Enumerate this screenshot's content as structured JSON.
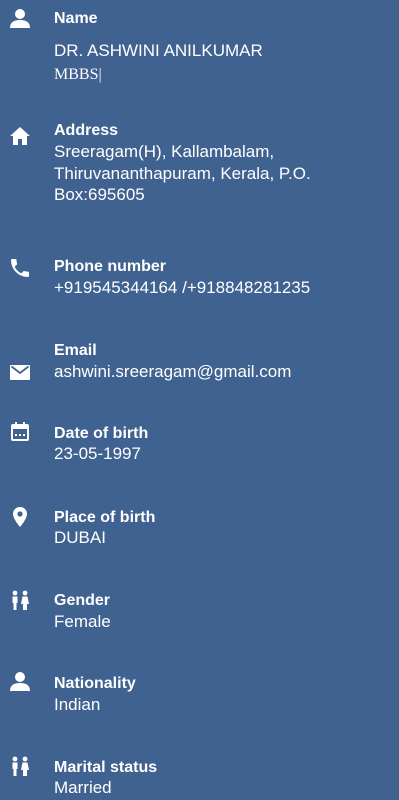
{
  "background_color": "#3f6290",
  "text_color": "#ffffff",
  "fields": {
    "name": {
      "icon": "person-icon",
      "label": "Name",
      "value": "DR. ASHWINI ANILKUMAR",
      "value_line2": "MBBS|"
    },
    "address": {
      "icon": "home-icon",
      "label": "Address",
      "line1": "Sreeragam(H), Kallambalam,",
      "line2": "Thiruvananthapuram, Kerala, P.O.",
      "line3": "Box:695605"
    },
    "phone": {
      "icon": "phone-icon",
      "label": "Phone number",
      "value": "+919545344164 /+918848281235"
    },
    "email": {
      "icon": "envelope-icon",
      "label": "Email",
      "value": "ashwini.sreeragam@gmail.com"
    },
    "dob": {
      "icon": "calendar-icon",
      "label": "Date of birth",
      "value": "23-05-1997"
    },
    "pob": {
      "icon": "location-pin-icon",
      "label": "Place of birth",
      "value": "DUBAI"
    },
    "gender": {
      "icon": "people-icon",
      "label": "Gender",
      "value": "Female"
    },
    "nationality": {
      "icon": "person-icon",
      "label": "Nationality",
      "value": "Indian"
    },
    "marital": {
      "icon": "people-icon",
      "label": "Marital status",
      "value": "Married"
    }
  }
}
